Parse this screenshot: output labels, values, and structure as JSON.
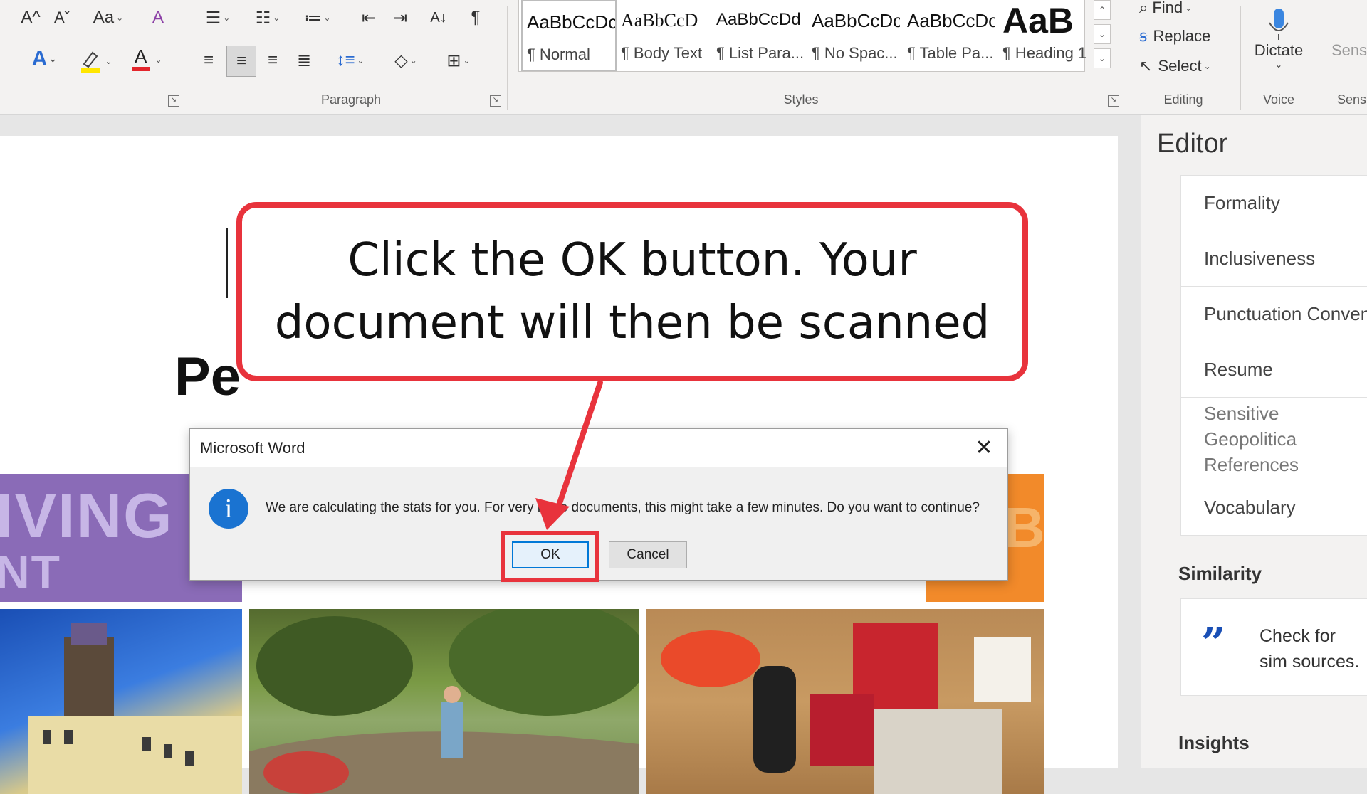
{
  "ribbon": {
    "font_group": {
      "grow_font": "A^",
      "shrink_font": "Aˇ",
      "change_case": "Aa",
      "font_color_accent": "#e3262c",
      "highlight_accent": "#ffe600",
      "text_effects_accent": "#2a6bd1"
    },
    "paragraph_label": "Paragraph",
    "styles_label": "Styles",
    "styles": [
      {
        "sample": "AaBbCcDc",
        "name": "¶ Normal",
        "selected": true
      },
      {
        "sample": "AaBbCcD",
        "name": "¶ Body Text"
      },
      {
        "sample": "AaBbCcDd",
        "name": "¶ List Para..."
      },
      {
        "sample": "AaBbCcDc",
        "name": "¶ No Spac..."
      },
      {
        "sample": "AaBbCcDc",
        "name": "¶ Table Pa..."
      },
      {
        "sample": "AaB",
        "name": "¶ Heading 1"
      }
    ],
    "editing": {
      "label": "Editing",
      "find": "Find",
      "replace": "Replace",
      "select": "Select"
    },
    "voice": {
      "label": "Voice",
      "dictate": "Dictate"
    },
    "sensitivity": {
      "label": "Sensi",
      "button": "Sensi"
    }
  },
  "document": {
    "heading_fragment": "Pe",
    "banner_lines": [
      "IVING &",
      "NT ECONOM"
    ],
    "banner_right_fragment": "B"
  },
  "editor_pane": {
    "title": "Editor",
    "items": [
      "Formality",
      "Inclusiveness",
      "Punctuation Conven",
      "Resume",
      "Sensitive Geopolitica References",
      "Vocabulary"
    ],
    "similarity_heading": "Similarity",
    "similarity_text": "Check for sim sources.",
    "insights_heading": "Insights"
  },
  "dialog": {
    "title": "Microsoft Word",
    "message": "We are calculating the stats for you. For very large documents, this might take a few minutes. Do you want to continue?",
    "ok_label": "OK",
    "cancel_label": "Cancel",
    "close_icon": "close-icon",
    "info_icon": "i"
  },
  "callout": {
    "text": "Click the OK button. Your document will then be scanned",
    "accent": "#e8333c"
  }
}
